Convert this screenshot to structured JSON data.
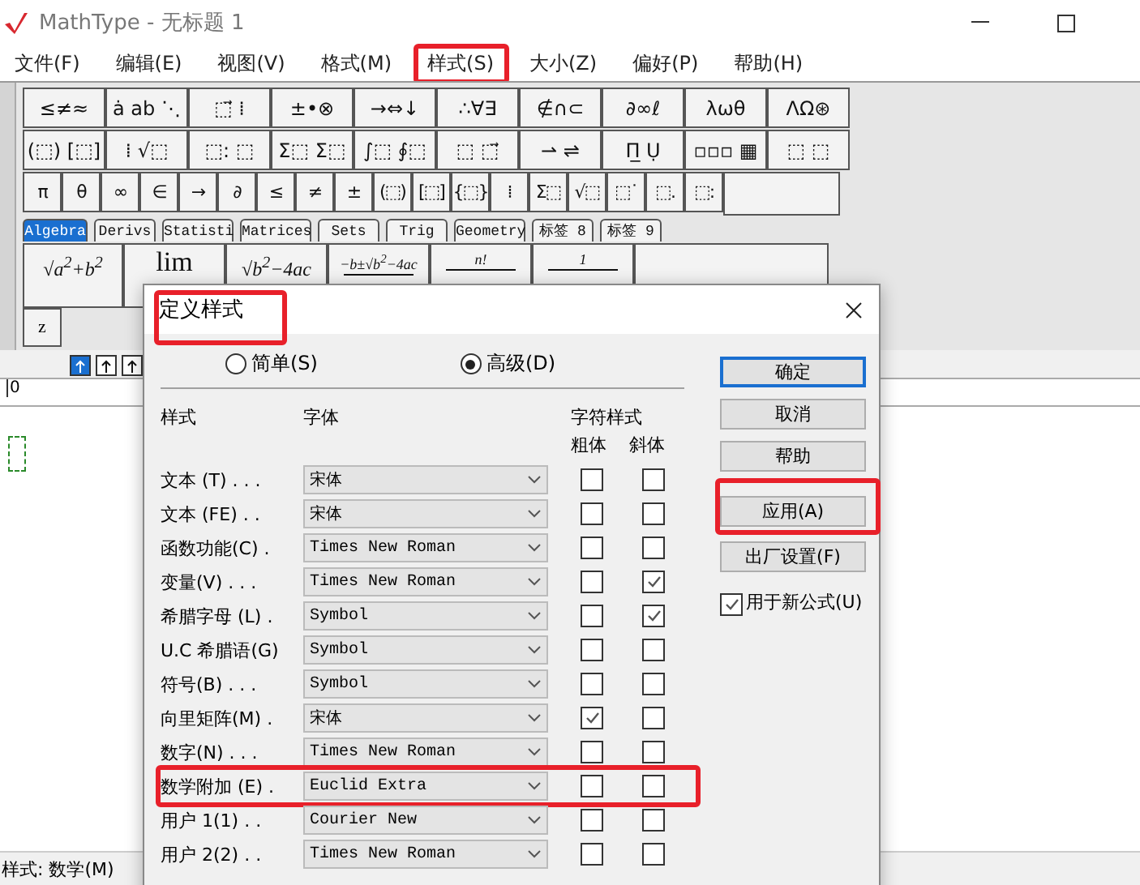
{
  "window": {
    "title": "MathType - 无标题 1"
  },
  "menu": [
    {
      "label": "文件(F)",
      "highlighted": false
    },
    {
      "label": "编辑(E)",
      "highlighted": false
    },
    {
      "label": "视图(V)",
      "highlighted": false
    },
    {
      "label": "格式(M)",
      "highlighted": false
    },
    {
      "label": "样式(S)",
      "highlighted": true
    },
    {
      "label": "大小(Z)",
      "highlighted": false
    },
    {
      "label": "偏好(P)",
      "highlighted": false
    },
    {
      "label": "帮助(H)",
      "highlighted": false
    }
  ],
  "palette": {
    "row_1": [
      "≤≠≈",
      "ȧ ab ⋱",
      "⬚⃗ ⁞",
      "±•⊗",
      "→⇔↓",
      "∴∀∃",
      "∉∩⊂",
      "∂∞ℓ",
      "λωθ",
      "ΛΩ⊛"
    ],
    "row_2": [
      "(⬚) [⬚]",
      "⁞ √⬚",
      "⬚: ⬚",
      "Σ⬚ Σ⬚",
      "∫⬚ ∮⬚",
      "⬚ ⬚⃗",
      "⇀ ⇌",
      "Π̲ Ụ",
      "▫▫▫ ▦",
      "⬚ ⬚"
    ],
    "row_3": [
      "π",
      "θ",
      "∞",
      "∈",
      "→",
      "∂",
      "≤",
      "≠",
      "±",
      "(⬚)",
      "[⬚]",
      "{⬚}",
      "⁞",
      "Σ⬚",
      "√⬚",
      "⬚˙",
      "⬚.",
      "⬚:"
    ]
  },
  "template_tabs": [
    {
      "label": "Algebra",
      "selected": true
    },
    {
      "label": "Derivs",
      "selected": false
    },
    {
      "label": "Statisti",
      "selected": false
    },
    {
      "label": "Matrices",
      "selected": false
    },
    {
      "label": "Sets",
      "selected": false
    },
    {
      "label": "Trig",
      "selected": false
    },
    {
      "label": "Geometry",
      "selected": false
    },
    {
      "label": "标签 8",
      "selected": false
    },
    {
      "label": "标签 9",
      "selected": false
    }
  ],
  "templates": [
    {
      "kind": "plain",
      "text": "√a$^{2}$+b$^{2}$"
    },
    {
      "kind": "big",
      "text": "lim"
    },
    {
      "kind": "plain",
      "text": "√b$^{2}$−4ac"
    },
    {
      "kind": "fraction",
      "text": "−b±√b$^{2}$−4ac"
    },
    {
      "kind": "fraction",
      "text": "n!"
    },
    {
      "kind": "fraction",
      "text": "1"
    }
  ],
  "template_row_2": [
    "z"
  ],
  "ruler": {
    "start": "0"
  },
  "status_bar": "样式: 数学(M)",
  "dialog": {
    "title": "定义样式",
    "title_highlighted": true,
    "modes": [
      {
        "label": "简单(S)",
        "selected": false
      },
      {
        "label": "高级(D)",
        "selected": true
      }
    ],
    "headers": {
      "style": "样式",
      "font": "字体",
      "char_style": "字符样式",
      "bold": "粗体",
      "italic": "斜体"
    },
    "rows": [
      {
        "label": "文本 (T) . . .",
        "font": "宋体",
        "bold": false,
        "italic": false,
        "highlighted": false
      },
      {
        "label": "文本 (FE) . .",
        "font": "宋体",
        "bold": false,
        "italic": false,
        "highlighted": false
      },
      {
        "label": "函数功能(C) .",
        "font": "Times New Roman",
        "bold": false,
        "italic": false,
        "highlighted": false
      },
      {
        "label": "变量(V) . . .",
        "font": "Times New Roman",
        "bold": false,
        "italic": true,
        "highlighted": false
      },
      {
        "label": "希腊字母 (L) .",
        "font": "Symbol",
        "bold": false,
        "italic": true,
        "highlighted": false
      },
      {
        "label": "U.C 希腊语(G)",
        "font": "Symbol",
        "bold": false,
        "italic": false,
        "highlighted": false
      },
      {
        "label": "符号(B) . . .",
        "font": "Symbol",
        "bold": false,
        "italic": false,
        "highlighted": false
      },
      {
        "label": "向里矩阵(M) .",
        "font": "宋体",
        "bold": true,
        "italic": false,
        "highlighted": false
      },
      {
        "label": "数字(N) . . .",
        "font": "Times New Roman",
        "bold": false,
        "italic": false,
        "highlighted": false
      },
      {
        "label": "数学附加 (E) .",
        "font": "Euclid Extra",
        "bold": false,
        "italic": false,
        "highlighted": true
      },
      {
        "label": "用户 1(1) . .",
        "font": "Courier New",
        "bold": false,
        "italic": false,
        "highlighted": false
      },
      {
        "label": "用户 2(2) . .",
        "font": "Times New Roman",
        "bold": false,
        "italic": false,
        "highlighted": false
      }
    ],
    "buttons": [
      {
        "label": "确定",
        "default": true,
        "highlighted": false
      },
      {
        "label": "取消",
        "default": false,
        "highlighted": false
      },
      {
        "label": "帮助",
        "default": false,
        "highlighted": false
      },
      {
        "label": "应用(A)",
        "default": false,
        "highlighted": true
      },
      {
        "label": "出厂设置(F)",
        "default": false,
        "highlighted": false
      }
    ],
    "use_for_new": {
      "label": "用于新公式(U)",
      "checked": true
    }
  }
}
